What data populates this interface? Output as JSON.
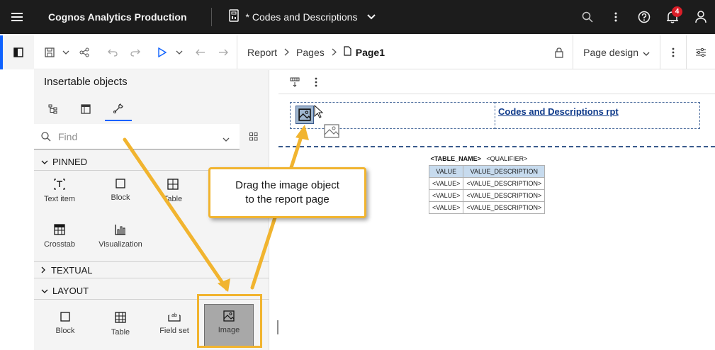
{
  "topbar": {
    "app_title": "Cognos Analytics Production",
    "doc_title": "* Codes and Descriptions",
    "notification_count": "4"
  },
  "toolbar": {
    "breadcrumb": [
      "Report",
      "Pages",
      "Page1"
    ],
    "page_design_label": "Page design"
  },
  "left_panel": {
    "title": "Insertable objects",
    "search_placeholder": "Find",
    "sections": {
      "pinned": "PINNED",
      "textual": "TEXTUAL",
      "layout": "LAYOUT"
    },
    "pinned_items": [
      "Text item",
      "Block",
      "Table",
      "Crosstab",
      "Visualization"
    ],
    "layout_items": [
      "Block",
      "Table",
      "Field set",
      "Image"
    ]
  },
  "canvas": {
    "report_title": "Codes and Descriptions rpt",
    "table": {
      "caption_name": "<TABLE_NAME>",
      "caption_qualifier": "<QUALIFIER>",
      "headers": [
        "VALUE",
        "VALUE_DESCRIPTION"
      ],
      "rows": [
        [
          "<VALUE>",
          "<VALUE_DESCRIPTION>"
        ],
        [
          "<VALUE>",
          "<VALUE_DESCRIPTION>"
        ],
        [
          "<VALUE>",
          "<VALUE_DESCRIPTION>"
        ]
      ]
    }
  },
  "callout": {
    "line1": "Drag the image object",
    "line2": "to the report page"
  },
  "colors": {
    "accent": "#0f62fe",
    "callout_border": "#f1b42f",
    "topbar_bg": "#1c1c1c",
    "badge": "#da1e28"
  }
}
